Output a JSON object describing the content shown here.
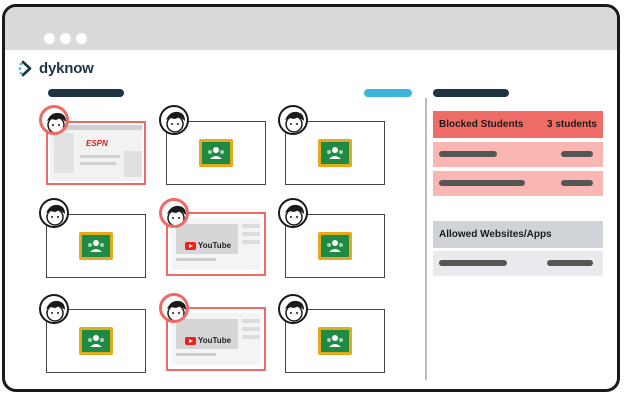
{
  "brand": {
    "name": "dyknow",
    "color": "#1d3443"
  },
  "colors": {
    "blocked": "#ef6a65",
    "accent_button": "#3bb6d9",
    "dark_bar": "#1d3443"
  },
  "grid": {
    "tiles": [
      {
        "content": "espn",
        "blocked": true
      },
      {
        "content": "google-classroom-icon",
        "blocked": false
      },
      {
        "content": "google-classroom-icon",
        "blocked": false
      },
      {
        "content": "google-classroom-icon",
        "blocked": false
      },
      {
        "content": "youtube",
        "blocked": true
      },
      {
        "content": "google-classroom-icon",
        "blocked": false
      },
      {
        "content": "google-classroom-icon",
        "blocked": false
      },
      {
        "content": "youtube",
        "blocked": true
      },
      {
        "content": "google-classroom-icon",
        "blocked": false
      }
    ],
    "espn_logo": "ESPN",
    "youtube_logo": "YouTube"
  },
  "panel": {
    "blocked": {
      "title": "Blocked Students",
      "count": "3 students"
    },
    "allowed": {
      "title": "Allowed Websites/Apps"
    }
  }
}
